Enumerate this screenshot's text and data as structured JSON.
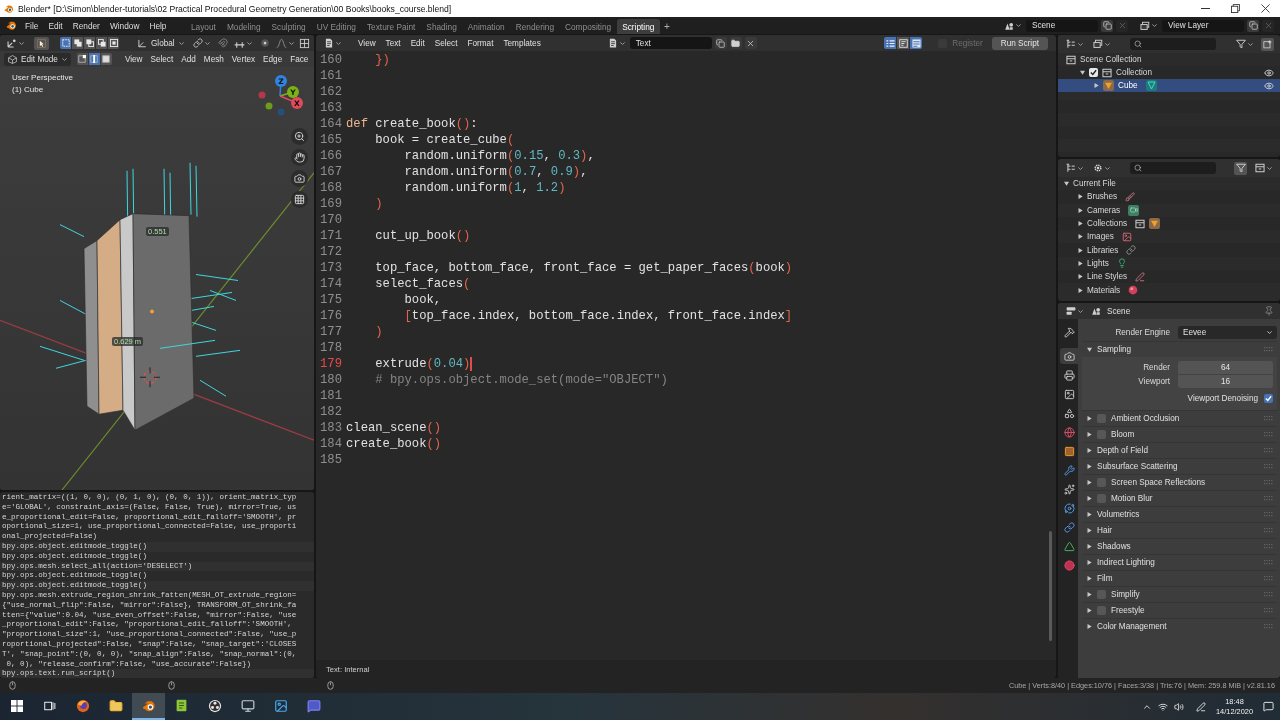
{
  "title_bar": {
    "title": "Blender* [D:\\Simon\\blender-tutorials\\02 Practical Procedural Geometry Generation\\00 Books\\books_course.blend]"
  },
  "top_bar": {
    "menus": [
      "File",
      "Edit",
      "Render",
      "Window",
      "Help"
    ],
    "workspaces": [
      {
        "label": "Layout",
        "selected": false
      },
      {
        "label": "Modeling",
        "selected": false
      },
      {
        "label": "Sculpting",
        "selected": false
      },
      {
        "label": "UV Editing",
        "selected": false
      },
      {
        "label": "Texture Paint",
        "selected": false
      },
      {
        "label": "Shading",
        "selected": false
      },
      {
        "label": "Animation",
        "selected": false
      },
      {
        "label": "Rendering",
        "selected": false
      },
      {
        "label": "Compositing",
        "selected": false
      },
      {
        "label": "Scripting",
        "selected": true
      }
    ],
    "add_workspace": "+",
    "scene": "Scene",
    "view_layer": "View Layer"
  },
  "viewport": {
    "tool_settings": {
      "select_modes": [
        {
          "selected": true
        },
        {
          "selected": false
        },
        {
          "selected": false
        },
        {
          "selected": false
        },
        {
          "selected": false
        }
      ],
      "orientation": "Global"
    },
    "mode": "Edit Mode",
    "mesh_select_modes": [
      {
        "selected": false
      },
      {
        "selected": true
      },
      {
        "selected": false
      }
    ],
    "menus": [
      "View",
      "Select",
      "Add",
      "Mesh",
      "Vertex",
      "Edge",
      "Face"
    ],
    "view_name": "User Perspective",
    "object_label": "(1) Cube",
    "edge_lengths": [
      "0.551",
      "0.629 m"
    ],
    "navigation_gizmo": [
      {
        "label": "Z"
      },
      {
        "label": "Y"
      },
      {
        "label": "X"
      }
    ]
  },
  "info_log": {
    "reports": [
      {
        "lines": [
          "rient_matrix=((1, 0, 0), (0, 1, 0), (0, 0, 1)), orient_matrix_typ",
          "e='GLOBAL', constraint_axis=(False, False, True), mirror=True, us",
          "e_proportional_edit=False, proportional_edit_falloff='SMOOTH', pr",
          "oportional_size=1, use_proportional_connected=False, use_proporti",
          "onal_projected=False)"
        ]
      },
      {
        "lines": [
          "bpy.ops.object.editmode_toggle()"
        ]
      },
      {
        "lines": [
          "bpy.ops.object.editmode_toggle()"
        ]
      },
      {
        "lines": [
          "bpy.ops.mesh.select_all(action='DESELECT')"
        ]
      },
      {
        "lines": [
          "bpy.ops.object.editmode_toggle()"
        ]
      },
      {
        "lines": [
          "bpy.ops.object.editmode_toggle()"
        ]
      },
      {
        "lines": [
          "bpy.ops.mesh.extrude_region_shrink_fatten(MESH_OT_extrude_region=",
          "{\"use_normal_flip\":False, \"mirror\":False}, TRANSFORM_OT_shrink_fa",
          "tten={\"value\":0.04, \"use_even_offset\":False, \"mirror\":False, \"use",
          "_proportional_edit\":False, \"proportional_edit_falloff\":'SMOOTH',",
          "\"proportional_size\":1, \"use_proportional_connected\":False, \"use_p",
          "roportional_projected\":False, \"snap\":False, \"snap_target\":'CLOSES",
          "T', \"snap_point\":(0, 0, 0), \"snap_align\":False, \"snap_normal\":(0,",
          " 0, 0), \"release_confirm\":False, \"use_accurate\":False})"
        ]
      },
      {
        "lines": [
          "bpy.ops.text.run_script()"
        ]
      }
    ]
  },
  "text_editor": {
    "header": {
      "menus": [
        "View",
        "Text",
        "Edit",
        "Select",
        "Format",
        "Templates"
      ],
      "text_name": "Text",
      "display_toggles": [
        {
          "on": true
        },
        {
          "on": false
        },
        {
          "on": true
        }
      ],
      "register": {
        "label": "Register",
        "checked": false,
        "disabled": true
      },
      "run_button": "Run Script"
    },
    "lines": [
      {
        "number": "160",
        "current": false,
        "tokens": [
          {
            "kind": "symbol",
            "text": "    })"
          }
        ]
      },
      {
        "number": "161",
        "current": false
      },
      {
        "number": "162",
        "current": false
      },
      {
        "number": "163",
        "current": false
      },
      {
        "number": "164",
        "current": false,
        "tokens": [
          {
            "kind": "keyword",
            "text": "def"
          },
          {
            "kind": "plain",
            "text": " create_book"
          },
          {
            "kind": "symbol",
            "text": "()"
          },
          {
            "kind": "plain",
            "text": ":"
          }
        ]
      },
      {
        "number": "165",
        "current": false,
        "tokens": [
          {
            "kind": "plain",
            "text": "    book = create_cube"
          },
          {
            "kind": "symbol",
            "text": "("
          }
        ]
      },
      {
        "number": "166",
        "current": false,
        "tokens": [
          {
            "kind": "plain",
            "text": "        random.uniform"
          },
          {
            "kind": "symbol",
            "text": "("
          },
          {
            "kind": "number",
            "text": "0.15"
          },
          {
            "kind": "plain",
            "text": ", "
          },
          {
            "kind": "number",
            "text": "0.3"
          },
          {
            "kind": "symbol",
            "text": ")"
          },
          {
            "kind": "plain",
            "text": ","
          }
        ]
      },
      {
        "number": "167",
        "current": false,
        "tokens": [
          {
            "kind": "plain",
            "text": "        random.uniform"
          },
          {
            "kind": "symbol",
            "text": "("
          },
          {
            "kind": "number",
            "text": "0.7"
          },
          {
            "kind": "plain",
            "text": ", "
          },
          {
            "kind": "number",
            "text": "0.9"
          },
          {
            "kind": "symbol",
            "text": ")"
          },
          {
            "kind": "plain",
            "text": ","
          }
        ]
      },
      {
        "number": "168",
        "current": false,
        "tokens": [
          {
            "kind": "plain",
            "text": "        random.uniform"
          },
          {
            "kind": "symbol",
            "text": "("
          },
          {
            "kind": "number",
            "text": "1"
          },
          {
            "kind": "plain",
            "text": ", "
          },
          {
            "kind": "number",
            "text": "1.2"
          },
          {
            "kind": "symbol",
            "text": ")"
          }
        ]
      },
      {
        "number": "169",
        "current": false,
        "tokens": [
          {
            "kind": "symbol",
            "text": "    )"
          }
        ]
      },
      {
        "number": "170",
        "current": false
      },
      {
        "number": "171",
        "current": false,
        "tokens": [
          {
            "kind": "plain",
            "text": "    cut_up_book"
          },
          {
            "kind": "symbol",
            "text": "()"
          }
        ]
      },
      {
        "number": "172",
        "current": false
      },
      {
        "number": "173",
        "current": false,
        "tokens": [
          {
            "kind": "plain",
            "text": "    top_face, bottom_face, front_face = get_paper_faces"
          },
          {
            "kind": "symbol",
            "text": "("
          },
          {
            "kind": "plain",
            "text": "book"
          },
          {
            "kind": "symbol",
            "text": ")"
          }
        ]
      },
      {
        "number": "174",
        "current": false,
        "tokens": [
          {
            "kind": "plain",
            "text": "    select_faces"
          },
          {
            "kind": "symbol",
            "text": "("
          }
        ]
      },
      {
        "number": "175",
        "current": false,
        "tokens": [
          {
            "kind": "plain",
            "text": "        book,"
          }
        ]
      },
      {
        "number": "176",
        "current": false,
        "tokens": [
          {
            "kind": "symbol",
            "text": "        ["
          },
          {
            "kind": "plain",
            "text": "top_face.index, bottom_face.index, front_face.index"
          },
          {
            "kind": "symbol",
            "text": "]"
          }
        ]
      },
      {
        "number": "177",
        "current": false,
        "tokens": [
          {
            "kind": "symbol",
            "text": "    )"
          }
        ]
      },
      {
        "number": "178",
        "current": false
      },
      {
        "number": "179",
        "current": true,
        "tokens": [
          {
            "kind": "plain",
            "text": "    extrude"
          },
          {
            "kind": "symbol",
            "text": "("
          },
          {
            "kind": "number",
            "text": "0.04"
          },
          {
            "kind": "symbol",
            "text": ")"
          }
        ]
      },
      {
        "number": "180",
        "current": false,
        "tokens": [
          {
            "kind": "comment",
            "text": "    # bpy.ops.object.mode_set(mode=\"OBJECT\")"
          }
        ]
      },
      {
        "number": "181",
        "current": false
      },
      {
        "number": "182",
        "current": false
      },
      {
        "number": "183",
        "current": false,
        "tokens": [
          {
            "kind": "plain",
            "text": "clean_scene"
          },
          {
            "kind": "symbol",
            "text": "()"
          }
        ]
      },
      {
        "number": "184",
        "current": false,
        "tokens": [
          {
            "kind": "plain",
            "text": "create_book"
          },
          {
            "kind": "symbol",
            "text": "()"
          }
        ]
      },
      {
        "number": "185",
        "current": false
      }
    ],
    "footer": "Text: Internal"
  },
  "outliner": {
    "tree": [
      {
        "label": "Scene Collection",
        "kind": "scene_collection",
        "selected": false,
        "children": [
          {
            "label": "Collection",
            "kind": "collection",
            "expanded": true,
            "checked": true,
            "visible": true,
            "selected": false,
            "children": [
              {
                "label": "Cube",
                "kind": "mesh_object",
                "expanded": false,
                "visible": true,
                "selected": true
              }
            ]
          }
        ]
      }
    ]
  },
  "blend_file_outliner": {
    "tree": [
      {
        "label": "Current File",
        "expanded": true,
        "selected": false,
        "children": [
          {
            "label": "Brushes",
            "kind": "brushes",
            "expanded": false,
            "selected": false
          },
          {
            "label": "Cameras",
            "kind": "cameras",
            "expanded": false,
            "selected": false
          },
          {
            "label": "Collections",
            "kind": "collections",
            "expanded": false,
            "selected": false
          },
          {
            "label": "Images",
            "kind": "images",
            "expanded": false,
            "selected": false
          },
          {
            "label": "Libraries",
            "kind": "libraries",
            "expanded": false,
            "selected": false
          },
          {
            "label": "Lights",
            "kind": "lights",
            "expanded": false,
            "selected": false
          },
          {
            "label": "Line Styles",
            "kind": "linestyles",
            "expanded": false,
            "selected": false
          },
          {
            "label": "Materials",
            "kind": "materials",
            "expanded": false,
            "selected": false
          }
        ]
      }
    ]
  },
  "properties": {
    "context": "Scene",
    "tabs": [
      {
        "kind": "tool",
        "selected": false
      },
      {
        "kind": "render",
        "selected": true
      },
      {
        "kind": "output",
        "selected": false
      },
      {
        "kind": "view_layer",
        "selected": false
      },
      {
        "kind": "scene",
        "selected": false
      },
      {
        "kind": "world",
        "selected": false
      },
      {
        "kind": "object",
        "selected": false
      },
      {
        "kind": "modifiers",
        "selected": false
      },
      {
        "kind": "particles",
        "selected": false
      },
      {
        "kind": "physics",
        "selected": false
      },
      {
        "kind": "constraints",
        "selected": false
      },
      {
        "kind": "data",
        "selected": false
      },
      {
        "kind": "material",
        "selected": false
      }
    ],
    "render_engine": {
      "label": "Render Engine",
      "value": "Eevee"
    },
    "panels": [
      {
        "kind": "plain",
        "title": "Sampling",
        "expanded": true,
        "fields": [
          {
            "label": "Render",
            "value": "64"
          },
          {
            "label": "Viewport",
            "value": "16"
          }
        ],
        "options": [
          {
            "label": "Viewport Denoising",
            "checked": true
          }
        ]
      },
      {
        "kind": "toggle",
        "title": "Ambient Occlusion",
        "expanded": false,
        "checked": false
      },
      {
        "kind": "toggle",
        "title": "Bloom",
        "expanded": false,
        "checked": false
      },
      {
        "kind": "plain",
        "title": "Depth of Field",
        "expanded": false
      },
      {
        "kind": "plain",
        "title": "Subsurface Scattering",
        "expanded": false
      },
      {
        "kind": "toggle",
        "title": "Screen Space Reflections",
        "expanded": false,
        "checked": false
      },
      {
        "kind": "toggle",
        "title": "Motion Blur",
        "expanded": false,
        "checked": false
      },
      {
        "kind": "plain",
        "title": "Volumetrics",
        "expanded": false
      },
      {
        "kind": "plain",
        "title": "Hair",
        "expanded": false
      },
      {
        "kind": "plain",
        "title": "Shadows",
        "expanded": false
      },
      {
        "kind": "plain",
        "title": "Indirect Lighting",
        "expanded": false
      },
      {
        "kind": "plain",
        "title": "Film",
        "expanded": false
      },
      {
        "kind": "toggle",
        "title": "Simplify",
        "expanded": false,
        "checked": false
      },
      {
        "kind": "toggle",
        "title": "Freestyle",
        "expanded": false,
        "checked": false
      },
      {
        "kind": "plain",
        "title": "Color Management",
        "expanded": false
      }
    ]
  },
  "status_bar": {
    "stats": "Cube | Verts:8/40 | Edges:10/76 | Faces:3/38 | Tris:76 | Mem: 259.8 MiB | v2.81.16"
  },
  "taskbar": {
    "apps": [
      {
        "kind": "browser",
        "active": false
      },
      {
        "kind": "files",
        "active": false
      },
      {
        "kind": "blender",
        "active": true
      },
      {
        "kind": "editor",
        "active": false
      },
      {
        "kind": "recorder",
        "active": false
      },
      {
        "kind": "utility",
        "active": false
      },
      {
        "kind": "photos",
        "active": false
      },
      {
        "kind": "chat",
        "active": false
      }
    ],
    "time": "18:48",
    "date": "14/12/2020"
  }
}
